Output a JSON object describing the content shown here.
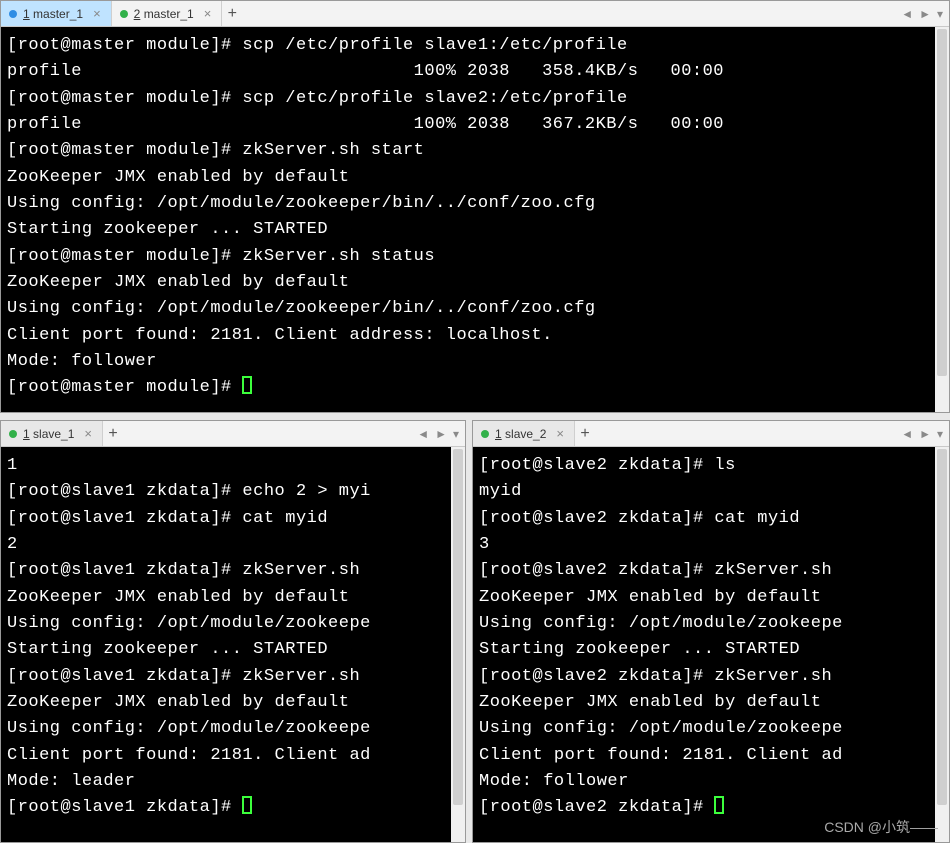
{
  "watermark": "CSDN @小筑——",
  "top": {
    "tabbar": {
      "tab1": {
        "num": "1",
        "label": "master_1",
        "close": "×"
      },
      "tab2": {
        "num": "2",
        "label": "master_1",
        "close": "×"
      },
      "add": "+",
      "nav": {
        "left": "◄",
        "right": "►",
        "menu": "▾"
      }
    },
    "lines": {
      "l0": "[root@master module]# scp /etc/profile slave1:/etc/profile",
      "l1": "profile                               100% 2038   358.4KB/s   00:00    ",
      "l2": "[root@master module]# scp /etc/profile slave2:/etc/profile",
      "l3": "profile                               100% 2038   367.2KB/s   00:00    ",
      "l4": "[root@master module]# zkServer.sh start",
      "l5": "ZooKeeper JMX enabled by default",
      "l6": "Using config: /opt/module/zookeeper/bin/../conf/zoo.cfg",
      "l7": "Starting zookeeper ... STARTED",
      "l8": "[root@master module]# zkServer.sh status",
      "l9": "ZooKeeper JMX enabled by default",
      "l10": "Using config: /opt/module/zookeeper/bin/../conf/zoo.cfg",
      "l11": "Client port found: 2181. Client address: localhost.",
      "l12": "Mode: follower",
      "l13": "[root@master module]# "
    }
  },
  "bl": {
    "tabbar": {
      "tab1": {
        "num": "1",
        "label": "slave_1",
        "close": "×"
      },
      "add": "+",
      "nav": {
        "left": "◄",
        "right": "►",
        "menu": "▾"
      }
    },
    "lines": {
      "l0": "1",
      "l1": "[root@slave1 zkdata]# echo 2 > myi",
      "l2": "[root@slave1 zkdata]# cat myid",
      "l3": "2",
      "l4": "[root@slave1 zkdata]# zkServer.sh ",
      "l5": "ZooKeeper JMX enabled by default",
      "l6": "Using config: /opt/module/zookeepe",
      "l7": "Starting zookeeper ... STARTED",
      "l8": "[root@slave1 zkdata]# zkServer.sh ",
      "l9": "ZooKeeper JMX enabled by default",
      "l10": "Using config: /opt/module/zookeepe",
      "l11": "Client port found: 2181. Client ad",
      "l12": "Mode: leader",
      "l13": "[root@slave1 zkdata]# "
    }
  },
  "br": {
    "tabbar": {
      "tab1": {
        "num": "1",
        "label": "slave_2",
        "close": "×"
      },
      "add": "+",
      "nav": {
        "left": "◄",
        "right": "►",
        "menu": "▾"
      }
    },
    "lines": {
      "l0": "[root@slave2 zkdata]# ls",
      "l1": "myid",
      "l2": "[root@slave2 zkdata]# cat myid",
      "l3": "3",
      "l4": "[root@slave2 zkdata]# zkServer.sh ",
      "l5": "ZooKeeper JMX enabled by default",
      "l6": "Using config: /opt/module/zookeepe",
      "l7": "Starting zookeeper ... STARTED",
      "l8": "[root@slave2 zkdata]# zkServer.sh ",
      "l9": "ZooKeeper JMX enabled by default",
      "l10": "Using config: /opt/module/zookeepe",
      "l11": "Client port found: 2181. Client ad",
      "l12": "Mode: follower",
      "l13": "[root@slave2 zkdata]# "
    }
  }
}
